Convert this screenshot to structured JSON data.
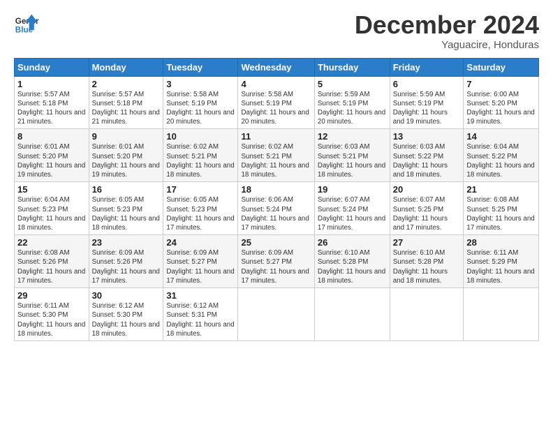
{
  "header": {
    "logo_line1": "General",
    "logo_line2": "Blue",
    "title": "December 2024",
    "location": "Yaguacire, Honduras"
  },
  "weekdays": [
    "Sunday",
    "Monday",
    "Tuesday",
    "Wednesday",
    "Thursday",
    "Friday",
    "Saturday"
  ],
  "weeks": [
    [
      {
        "day": "1",
        "sunrise": "5:57 AM",
        "sunset": "5:18 PM",
        "daylight": "11 hours and 21 minutes."
      },
      {
        "day": "2",
        "sunrise": "5:57 AM",
        "sunset": "5:18 PM",
        "daylight": "11 hours and 21 minutes."
      },
      {
        "day": "3",
        "sunrise": "5:58 AM",
        "sunset": "5:19 PM",
        "daylight": "11 hours and 20 minutes."
      },
      {
        "day": "4",
        "sunrise": "5:58 AM",
        "sunset": "5:19 PM",
        "daylight": "11 hours and 20 minutes."
      },
      {
        "day": "5",
        "sunrise": "5:59 AM",
        "sunset": "5:19 PM",
        "daylight": "11 hours and 20 minutes."
      },
      {
        "day": "6",
        "sunrise": "5:59 AM",
        "sunset": "5:19 PM",
        "daylight": "11 hours and 19 minutes."
      },
      {
        "day": "7",
        "sunrise": "6:00 AM",
        "sunset": "5:20 PM",
        "daylight": "11 hours and 19 minutes."
      }
    ],
    [
      {
        "day": "8",
        "sunrise": "6:01 AM",
        "sunset": "5:20 PM",
        "daylight": "11 hours and 19 minutes."
      },
      {
        "day": "9",
        "sunrise": "6:01 AM",
        "sunset": "5:20 PM",
        "daylight": "11 hours and 19 minutes."
      },
      {
        "day": "10",
        "sunrise": "6:02 AM",
        "sunset": "5:21 PM",
        "daylight": "11 hours and 18 minutes."
      },
      {
        "day": "11",
        "sunrise": "6:02 AM",
        "sunset": "5:21 PM",
        "daylight": "11 hours and 18 minutes."
      },
      {
        "day": "12",
        "sunrise": "6:03 AM",
        "sunset": "5:21 PM",
        "daylight": "11 hours and 18 minutes."
      },
      {
        "day": "13",
        "sunrise": "6:03 AM",
        "sunset": "5:22 PM",
        "daylight": "11 hours and 18 minutes."
      },
      {
        "day": "14",
        "sunrise": "6:04 AM",
        "sunset": "5:22 PM",
        "daylight": "11 hours and 18 minutes."
      }
    ],
    [
      {
        "day": "15",
        "sunrise": "6:04 AM",
        "sunset": "5:23 PM",
        "daylight": "11 hours and 18 minutes."
      },
      {
        "day": "16",
        "sunrise": "6:05 AM",
        "sunset": "5:23 PM",
        "daylight": "11 hours and 18 minutes."
      },
      {
        "day": "17",
        "sunrise": "6:05 AM",
        "sunset": "5:23 PM",
        "daylight": "11 hours and 17 minutes."
      },
      {
        "day": "18",
        "sunrise": "6:06 AM",
        "sunset": "5:24 PM",
        "daylight": "11 hours and 17 minutes."
      },
      {
        "day": "19",
        "sunrise": "6:07 AM",
        "sunset": "5:24 PM",
        "daylight": "11 hours and 17 minutes."
      },
      {
        "day": "20",
        "sunrise": "6:07 AM",
        "sunset": "5:25 PM",
        "daylight": "11 hours and 17 minutes."
      },
      {
        "day": "21",
        "sunrise": "6:08 AM",
        "sunset": "5:25 PM",
        "daylight": "11 hours and 17 minutes."
      }
    ],
    [
      {
        "day": "22",
        "sunrise": "6:08 AM",
        "sunset": "5:26 PM",
        "daylight": "11 hours and 17 minutes."
      },
      {
        "day": "23",
        "sunrise": "6:09 AM",
        "sunset": "5:26 PM",
        "daylight": "11 hours and 17 minutes."
      },
      {
        "day": "24",
        "sunrise": "6:09 AM",
        "sunset": "5:27 PM",
        "daylight": "11 hours and 17 minutes."
      },
      {
        "day": "25",
        "sunrise": "6:09 AM",
        "sunset": "5:27 PM",
        "daylight": "11 hours and 17 minutes."
      },
      {
        "day": "26",
        "sunrise": "6:10 AM",
        "sunset": "5:28 PM",
        "daylight": "11 hours and 18 minutes."
      },
      {
        "day": "27",
        "sunrise": "6:10 AM",
        "sunset": "5:28 PM",
        "daylight": "11 hours and 18 minutes."
      },
      {
        "day": "28",
        "sunrise": "6:11 AM",
        "sunset": "5:29 PM",
        "daylight": "11 hours and 18 minutes."
      }
    ],
    [
      {
        "day": "29",
        "sunrise": "6:11 AM",
        "sunset": "5:30 PM",
        "daylight": "11 hours and 18 minutes."
      },
      {
        "day": "30",
        "sunrise": "6:12 AM",
        "sunset": "5:30 PM",
        "daylight": "11 hours and 18 minutes."
      },
      {
        "day": "31",
        "sunrise": "6:12 AM",
        "sunset": "5:31 PM",
        "daylight": "11 hours and 18 minutes."
      },
      null,
      null,
      null,
      null
    ]
  ]
}
